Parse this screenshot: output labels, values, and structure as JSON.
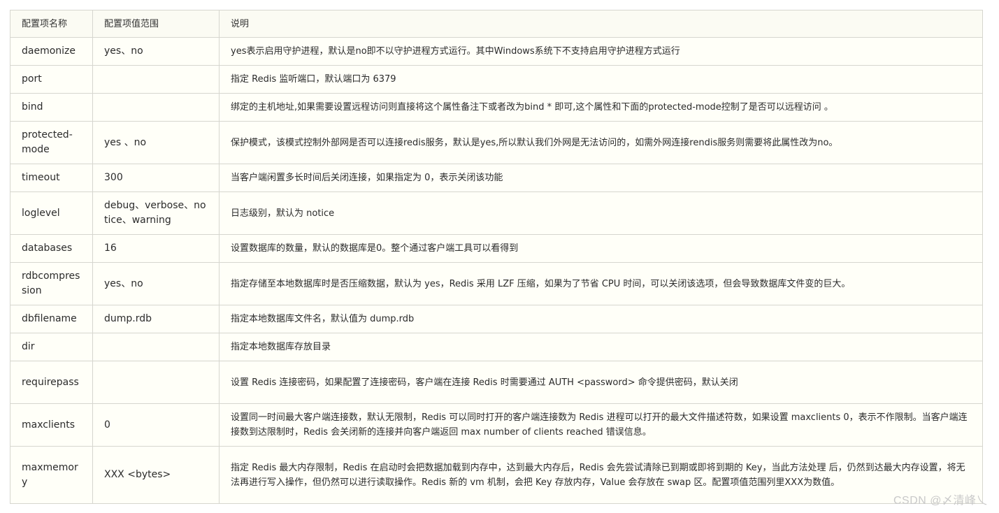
{
  "table": {
    "headers": [
      "配置项名称",
      "配置项值范围",
      "说明"
    ],
    "rows": [
      {
        "name": "daemonize",
        "range": "yes、no",
        "desc": "yes表示启用守护进程，默认是no即不以守护进程方式运行。其中Windows系统下不支持启用守护进程方式运行"
      },
      {
        "name": "port",
        "range": "",
        "desc": "指定 Redis 监听端口，默认端口为 6379"
      },
      {
        "name": "bind",
        "range": "",
        "desc": "绑定的主机地址,如果需要设置远程访问则直接将这个属性备注下或者改为bind * 即可,这个属性和下面的protected-mode控制了是否可以远程访问 。"
      },
      {
        "name": "protected-mode",
        "range": "yes 、no",
        "desc": "保护模式，该模式控制外部网是否可以连接redis服务，默认是yes,所以默认我们外网是无法访问的，如需外网连接rendis服务则需要将此属性改为no。"
      },
      {
        "name": "timeout",
        "range": "300",
        "desc": "当客户端闲置多长时间后关闭连接，如果指定为 0，表示关闭该功能"
      },
      {
        "name": "loglevel",
        "range": "debug、verbose、notice、warning",
        "desc": "日志级别，默认为 notice"
      },
      {
        "name": "databases",
        "range": "16",
        "desc": "设置数据库的数量，默认的数据库是0。整个通过客户端工具可以看得到"
      },
      {
        "name": "rdbcompression",
        "range": "yes、no",
        "desc": "指定存储至本地数据库时是否压缩数据，默认为 yes，Redis 采用 LZF 压缩，如果为了节省 CPU 时间，可以关闭该选项，但会导致数据库文件变的巨大。"
      },
      {
        "name": "dbfilename",
        "range": "dump.rdb",
        "desc": "指定本地数据库文件名，默认值为 dump.rdb"
      },
      {
        "name": "dir",
        "range": "",
        "desc": "指定本地数据库存放目录"
      },
      {
        "name": "requirepass",
        "range": "",
        "desc": "设置 Redis 连接密码，如果配置了连接密码，客户端在连接 Redis 时需要通过 AUTH <password> 命令提供密码，默认关闭"
      },
      {
        "name": "maxclients",
        "range": "0",
        "desc": "设置同一时间最大客户端连接数，默认无限制，Redis 可以同时打开的客户端连接数为 Redis 进程可以打开的最大文件描述符数，如果设置 maxclients 0，表示不作限制。当客户端连接数到达限制时，Redis 会关闭新的连接并向客户端返回 max number of clients reached 错误信息。"
      },
      {
        "name": "maxmemory",
        "range": "XXX <bytes>",
        "desc": "指定 Redis 最大内存限制，Redis 在启动时会把数据加载到内存中，达到最大内存后，Redis 会先尝试清除已到期或即将到期的 Key，当此方法处理 后，仍然到达最大内存设置，将无法再进行写入操作，但仍然可以进行读取操作。Redis 新的 vm 机制，会把 Key 存放内存，Value 会存放在 swap 区。配置项值范围列里XXX为数值。"
      }
    ]
  },
  "watermark": "CSDN @〆清峰乀"
}
